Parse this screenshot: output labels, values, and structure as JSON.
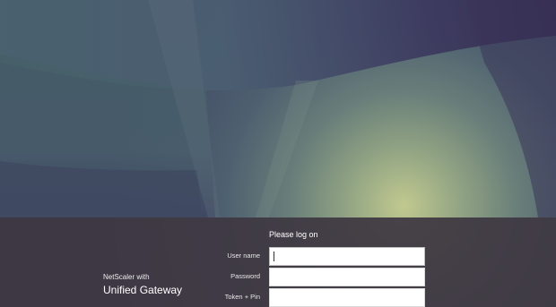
{
  "branding": {
    "product_prefix": "NetScaler with",
    "product_name": "Unified Gateway"
  },
  "form": {
    "title": "Please log on",
    "fields": [
      {
        "label": "User name",
        "value": "",
        "focused": true
      },
      {
        "label": "Password",
        "value": ""
      },
      {
        "label": "Token + Pin",
        "value": ""
      }
    ]
  },
  "colors": {
    "sky_dark": "#3b3558",
    "sky_teal": "#4a6a74",
    "glow": "#b7c38a",
    "panel": "#3e3842",
    "input_bg": "#ffffff"
  }
}
